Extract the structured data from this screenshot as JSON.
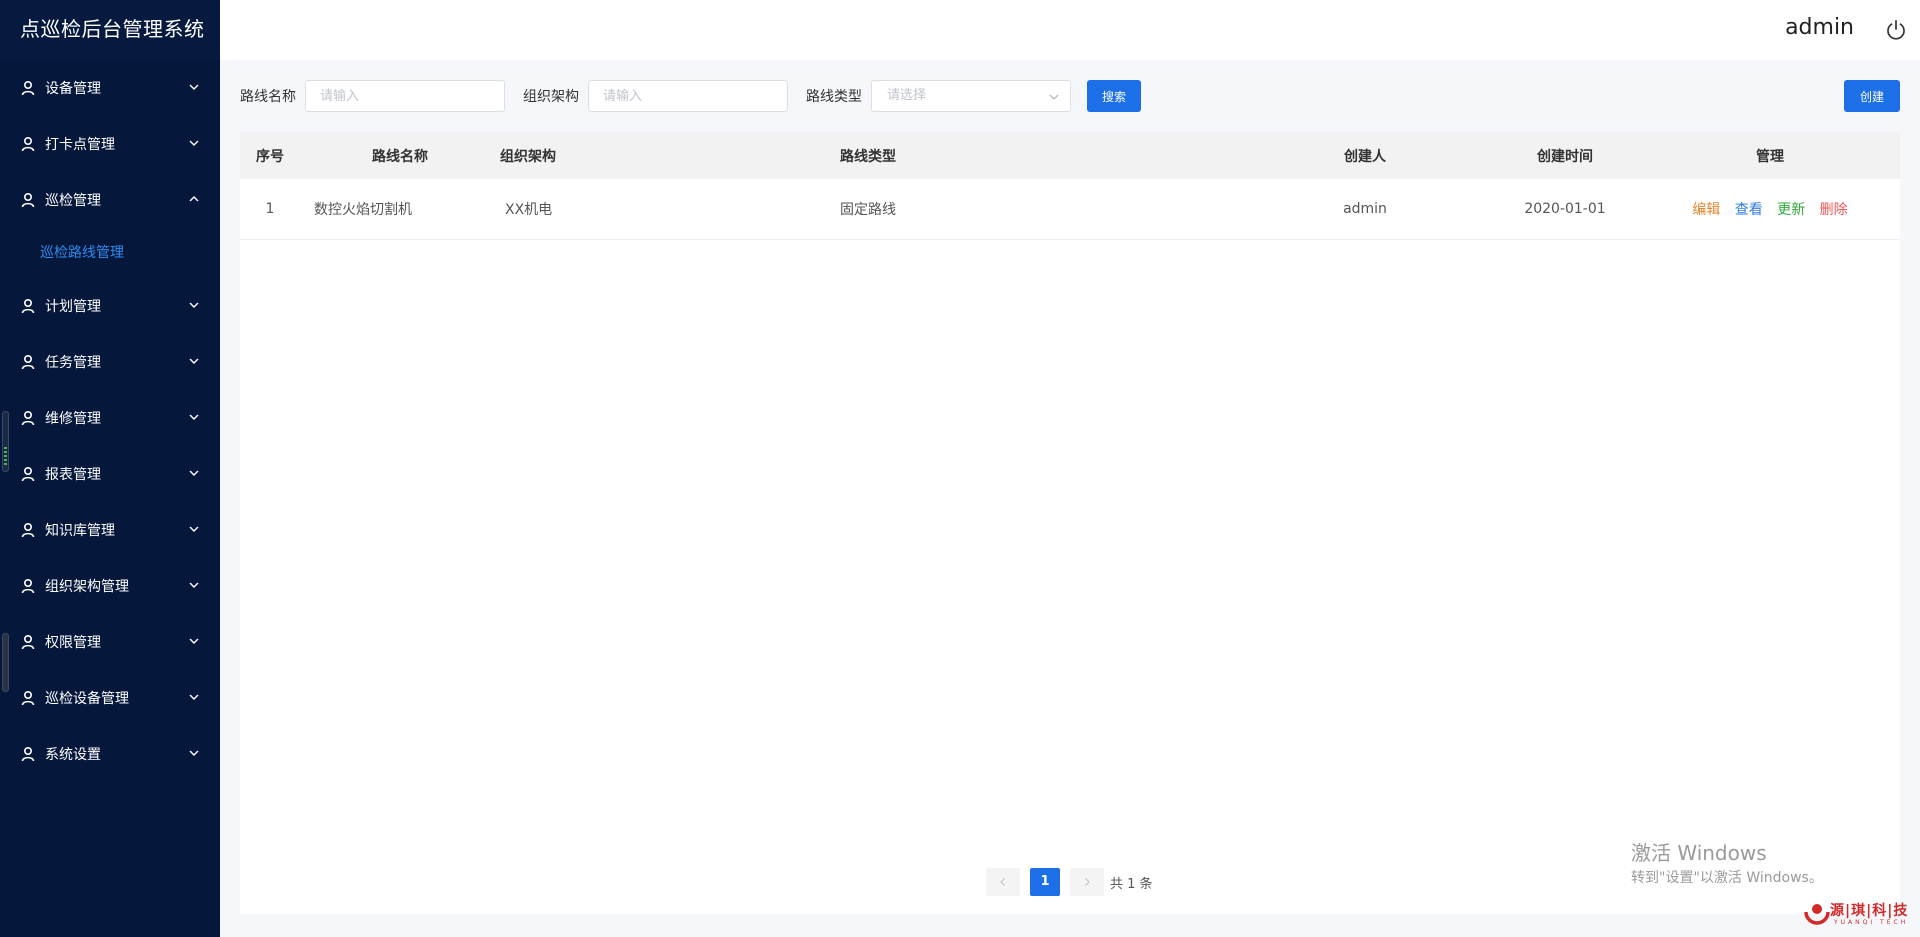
{
  "app": {
    "title": "点巡检后台管理系统"
  },
  "header": {
    "user": "admin",
    "power_icon": "power-icon"
  },
  "sidebar": {
    "items": [
      {
        "label": "设备管理",
        "expanded": false
      },
      {
        "label": "打卡点管理",
        "expanded": false
      },
      {
        "label": "巡检管理",
        "expanded": true,
        "children": [
          {
            "label": "巡检路线管理",
            "active": true
          }
        ]
      },
      {
        "label": "计划管理",
        "expanded": false
      },
      {
        "label": "任务管理",
        "expanded": false
      },
      {
        "label": "维修管理",
        "expanded": false
      },
      {
        "label": "报表管理",
        "expanded": false
      },
      {
        "label": "知识库管理",
        "expanded": false
      },
      {
        "label": "组织架构管理",
        "expanded": false
      },
      {
        "label": "权限管理",
        "expanded": false
      },
      {
        "label": "巡检设备管理",
        "expanded": false
      },
      {
        "label": "系统设置",
        "expanded": false
      }
    ]
  },
  "filters": {
    "route_name": {
      "label": "路线名称",
      "placeholder": "请输入",
      "value": ""
    },
    "org": {
      "label": "组织架构",
      "placeholder": "请输入",
      "value": ""
    },
    "route_type": {
      "label": "路线类型",
      "placeholder": "请选择",
      "value": ""
    },
    "search_label": "搜索",
    "create_label": "创建"
  },
  "table": {
    "columns": [
      "序号",
      "路线名称",
      "组织架构",
      "路线类型",
      "创建人",
      "创建时间",
      "管理"
    ],
    "rows": [
      {
        "index": "1",
        "name": "数控火焰切割机",
        "org": "XX机电",
        "type": "固定路线",
        "creator": "admin",
        "created": "2020-01-01"
      }
    ],
    "actions": {
      "edit": "编辑",
      "view": "查看",
      "update": "更新",
      "delete": "删除"
    }
  },
  "pagination": {
    "current": "1",
    "total_text": "共 1 条"
  },
  "watermark": {
    "windows_line1": "激活 Windows",
    "windows_line2": "转到\"设置\"以激活 Windows。",
    "brand_cn": "源|琪|科|技",
    "brand_en": "YUANQI TECH"
  },
  "colors": {
    "sidebar_bg": "#05173b",
    "primary": "#1c6fe6",
    "submenu_active": "#2d8cf0",
    "edit": "#e6862b",
    "view": "#2d7ae0",
    "update": "#2fa83a",
    "delete": "#f35454"
  }
}
